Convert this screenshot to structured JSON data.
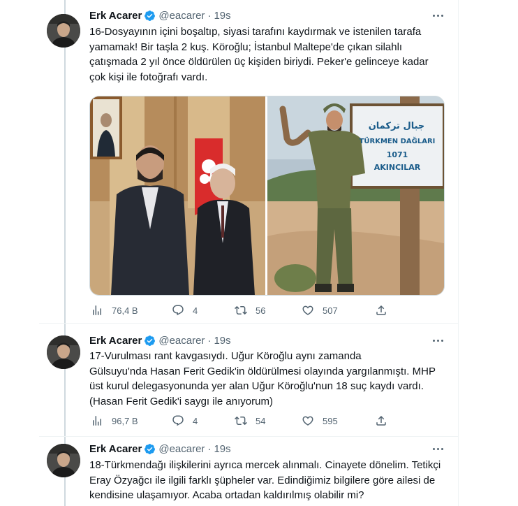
{
  "tweets": [
    {
      "author": {
        "name": "Erk Acarer",
        "handle": "@eacarer"
      },
      "dot": "·",
      "time": "19s",
      "text": "16-Dosyayının içini boşaltıp, siyasi tarafını kaydırmak ve istenilen tarafa\nyamamak! Bir taşla 2 kuş. Köroğlu; İstanbul Maltepe'de çıkan silahlı\nçatışmada 2 yıl önce öldürülen üç kişiden biriydi. Peker'e gelinceye kadar\nçok kişi ile fotoğrafı vardı.",
      "media": {
        "sign_arabic": "جبال تركمان",
        "sign_line1": "TÜRKMEN DAĞLARI",
        "sign_line2": "1071",
        "sign_line3": "AKINCILAR"
      },
      "stats": {
        "views": "76,4 B",
        "replies": "4",
        "retweets": "56",
        "likes": "507"
      }
    },
    {
      "author": {
        "name": "Erk Acarer",
        "handle": "@eacarer"
      },
      "dot": "·",
      "time": "19s",
      "text": "17-Vurulması rant kavgasıydı. Uğur Köroğlu aynı zamanda\nGülsuyu'nda Hasan Ferit Gedik'in öldürülmesi olayında yargılanmıştı. MHP\nüst kurul delegasyonunda yer alan Uğur Köroğlu'nun 18 suç kaydı vardı.\n(Hasan Ferit Gedik'i saygı ile anıyorum)",
      "stats": {
        "views": "96,7 B",
        "replies": "4",
        "retweets": "54",
        "likes": "595"
      }
    },
    {
      "author": {
        "name": "Erk Acarer",
        "handle": "@eacarer"
      },
      "dot": "·",
      "time": "19s",
      "text": "18-Türkmendağı ilişkilerini ayrıca mercek alınmalı. Cinayete dönelim. Tetikçi\nEray Özyağcı ile ilgili farklı şüpheler var. Edindiğimiz bilgilere göre ailesi de\nkendisine ulaşamıyor. Acaba ortadan kaldırılmış olabilir mi?"
    }
  ],
  "colors": {
    "verified": "#1d9bf0",
    "muted": "#536471",
    "text": "#0f1419",
    "divider": "#eff3f4"
  }
}
